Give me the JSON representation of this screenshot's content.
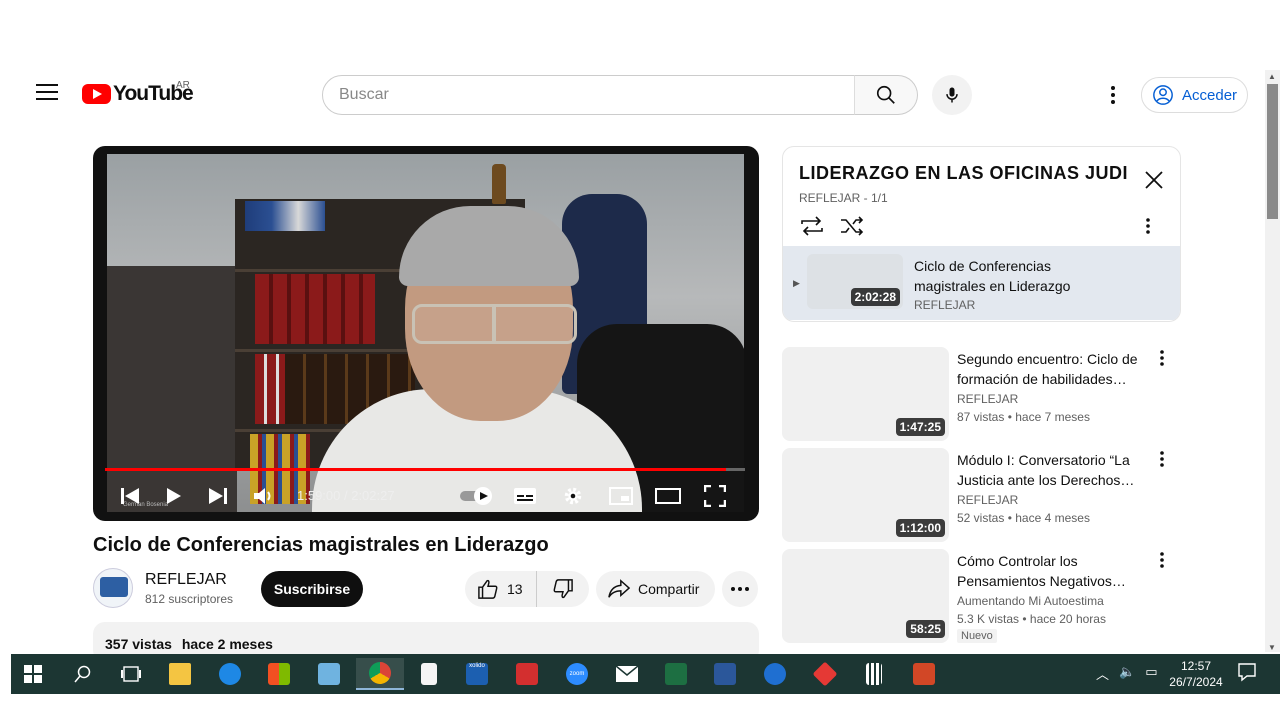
{
  "header": {
    "logo_text": "YouTube",
    "country_code": "AR",
    "search_placeholder": "Buscar",
    "signin_label": "Acceder"
  },
  "player": {
    "current_time": "1:59:00",
    "duration": "2:02:27",
    "time_display": "1:59:00 / 2:02:27",
    "progress_percent": 97,
    "watermark": "German Bosenia"
  },
  "video": {
    "title": "Ciclo de Conferencias magistrales en Liderazgo",
    "channel": "REFLEJAR",
    "subscribers": "812 suscriptores",
    "subscribe_label": "Suscribirse",
    "likes": "13",
    "share_label": "Compartir",
    "views": "357 vistas",
    "date": "hace 2 meses"
  },
  "playlist": {
    "title": "LIDERAZGO EN LAS OFICINAS JUDI…",
    "subtitle": "REFLEJAR - 1/1",
    "item": {
      "title": "Ciclo de Conferencias magistrales en Liderazgo",
      "duration": "2:02:28",
      "channel": "REFLEJAR"
    }
  },
  "recommendations": [
    {
      "title": "Segundo encuentro: Ciclo de formación de habilidades…",
      "channel": "REFLEJAR",
      "views": "87 vistas",
      "age": "hace 7 meses",
      "duration": "1:47:25"
    },
    {
      "title": "Módulo I: Conversatorio “La Justicia ante los Derechos…",
      "channel": "REFLEJAR",
      "views": "52 vistas",
      "age": "hace 4 meses",
      "duration": "1:12:00"
    },
    {
      "title": "Cómo Controlar los Pensamientos Negativos…",
      "channel": "Aumentando Mi Autoestima",
      "views": "5.3 K vistas",
      "age": "hace 20 horas",
      "duration": "58:25",
      "badge": "Nuevo"
    }
  ],
  "taskbar": {
    "time": "12:57",
    "date": "26/7/2024",
    "apps": [
      "start-icon",
      "search-icon",
      "task-view-icon",
      "file-explorer-icon",
      "edge-icon",
      "store-icon",
      "outlook-contacts-icon",
      "chrome-icon",
      "notepad-icon",
      "xolido-icon",
      "acrobat-icon",
      "zoom-icon",
      "mail-icon",
      "excel-icon",
      "word-icon",
      "thunderbird-icon",
      "anydesk-icon",
      "calculator-icon",
      "powerpoint-icon"
    ],
    "zoom_label": "zoom",
    "xolido_label": "xolido"
  },
  "colors": {
    "youtube_red": "#ff0000",
    "link_blue": "#065fd4",
    "taskbar_bg": "#1c3633",
    "playlist_selected": "#e3e8ef"
  }
}
